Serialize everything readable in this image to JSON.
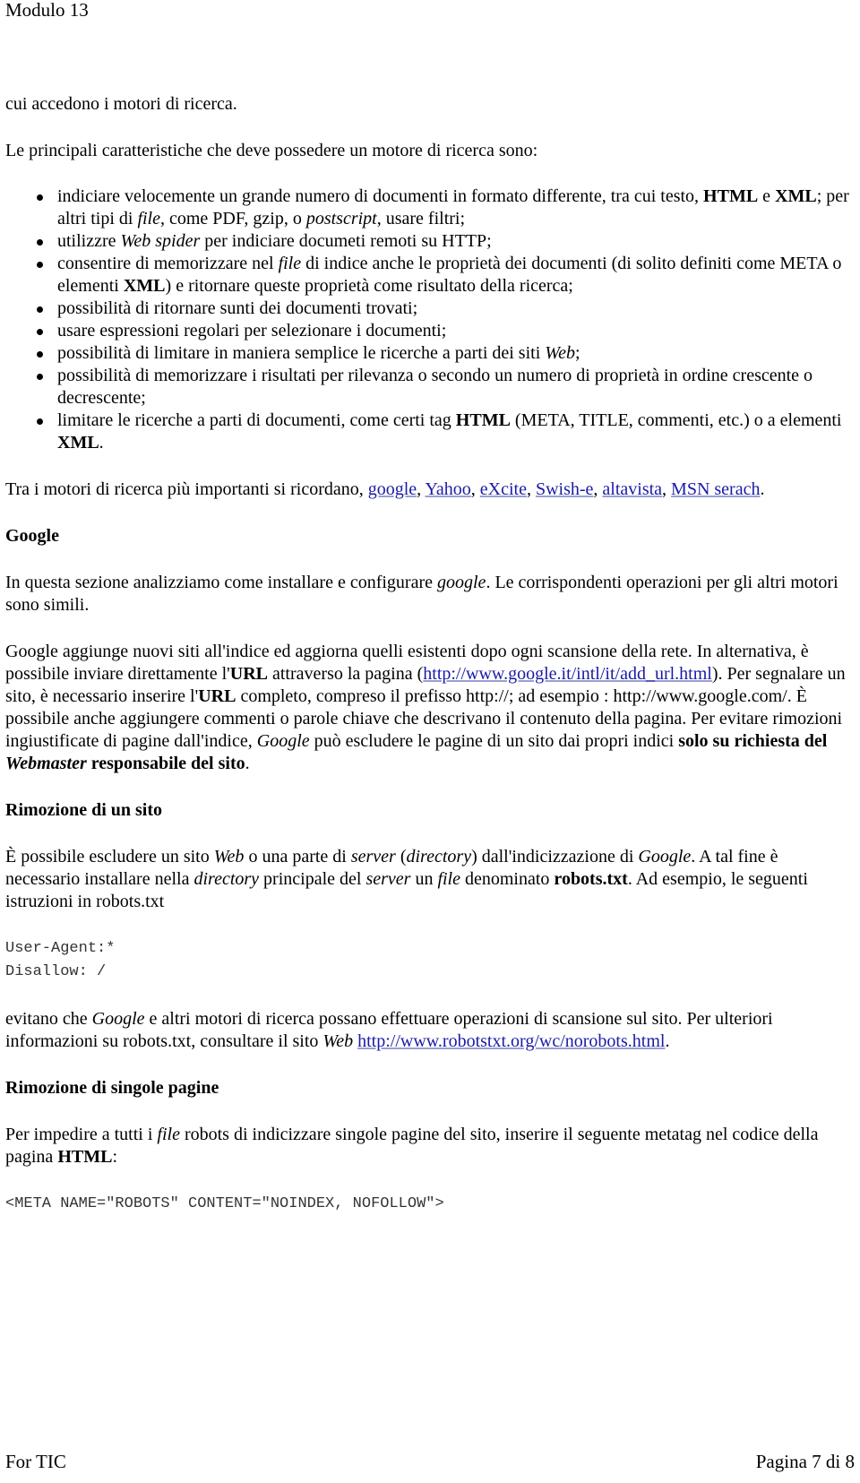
{
  "header": {
    "title": "Modulo 13"
  },
  "intro": {
    "continuation": "cui accedono i motori di ricerca.",
    "features_lead": "Le principali caratteristiche che deve possedere un motore di ricerca sono:"
  },
  "features": [
    {
      "parts": [
        {
          "t": "indiciare velocemente un grande numero di documenti in formato differente, tra cui testo, "
        },
        {
          "t": "HTML",
          "b": true
        },
        {
          "t": " e "
        },
        {
          "t": "XML",
          "b": true
        },
        {
          "t": "; per altri tipi di "
        },
        {
          "t": "file",
          "i": true
        },
        {
          "t": ", come PDF, gzip, o "
        },
        {
          "t": "postscript",
          "i": true
        },
        {
          "t": ", usare filtri;"
        }
      ]
    },
    {
      "parts": [
        {
          "t": "utilizzre "
        },
        {
          "t": "Web spider",
          "i": true
        },
        {
          "t": " per indiciare documeti remoti su HTTP;"
        }
      ]
    },
    {
      "parts": [
        {
          "t": "consentire di memorizzare nel "
        },
        {
          "t": "file",
          "i": true
        },
        {
          "t": " di indice anche le proprietà dei documenti (di solito definiti come META o elementi "
        },
        {
          "t": "XML",
          "b": true
        },
        {
          "t": ") e ritornare queste proprietà come risultato della ricerca;"
        }
      ]
    },
    {
      "parts": [
        {
          "t": "possibilità di ritornare sunti dei documenti trovati;"
        }
      ]
    },
    {
      "parts": [
        {
          "t": "usare espressioni regolari per selezionare i documenti;"
        }
      ]
    },
    {
      "parts": [
        {
          "t": "possibilità di limitare in maniera semplice le ricerche a parti dei siti "
        },
        {
          "t": "Web",
          "i": true
        },
        {
          "t": ";"
        }
      ]
    },
    {
      "parts": [
        {
          "t": "possibilità di memorizzare i risultati per rilevanza o secondo un numero di proprietà in ordine crescente o decrescente;"
        }
      ]
    },
    {
      "parts": [
        {
          "t": "limitare le ricerche a parti di documenti, come certi tag "
        },
        {
          "t": "HTML",
          "b": true
        },
        {
          "t": " (META, TITLE, commenti, etc.) o a elementi "
        },
        {
          "t": "XML",
          "b": true
        },
        {
          "t": "."
        }
      ]
    }
  ],
  "engines": {
    "lead": "Tra i motori di ricerca più importanti si ricordano, ",
    "links": [
      "google",
      "Yahoo",
      "eXcite",
      "Swish-e",
      "altavista",
      "MSN serach"
    ],
    "separator": ", ",
    "end": "."
  },
  "google_section": {
    "heading": "Google",
    "p1": [
      {
        "t": "In questa sezione analizziamo come installare e configurare "
      },
      {
        "t": "google",
        "i": true
      },
      {
        "t": ". Le corrispondenti operazioni per gli altri motori sono simili."
      }
    ],
    "p2": [
      {
        "t": "Google aggiunge nuovi siti all'indice ed aggiorna quelli esistenti dopo ogni scansione della rete. In alternativa, è possibile inviare direttamente l'"
      },
      {
        "t": "URL",
        "b": true
      },
      {
        "t": " attraverso la pagina ("
      },
      {
        "t": "http://www.google.it/intl/it/add_url.html",
        "link": true
      },
      {
        "t": "). Per segnalare un sito, è necessario inserire l'"
      },
      {
        "t": "URL",
        "b": true
      },
      {
        "t": " completo, compreso il prefisso http://; ad esempio : http://www.google.com/. È possibile anche aggiungere commenti o parole chiave che descrivano il contenuto della pagina. Per evitare rimozioni ingiustificate di pagine dall'indice, "
      },
      {
        "t": "Google",
        "i": true
      },
      {
        "t": " può escludere le pagine di un sito dai propri indici "
      },
      {
        "t": "solo su richiesta del ",
        "b": true
      },
      {
        "t": "Webmaster",
        "b": true,
        "i": true
      },
      {
        "t": " responsabile del sito",
        "b": true
      },
      {
        "t": "."
      }
    ]
  },
  "site_removal": {
    "heading": "Rimozione di un sito",
    "p1": [
      {
        "t": "È possibile escludere un sito "
      },
      {
        "t": "Web",
        "i": true
      },
      {
        "t": " o una parte di "
      },
      {
        "t": "server",
        "i": true
      },
      {
        "t": " ("
      },
      {
        "t": "directory",
        "i": true
      },
      {
        "t": ") dall'indicizzazione di "
      },
      {
        "t": "Google",
        "i": true
      },
      {
        "t": ". A tal fine è necessario installare nella "
      },
      {
        "t": "directory",
        "i": true
      },
      {
        "t": " principale del "
      },
      {
        "t": "server",
        "i": true
      },
      {
        "t": " un "
      },
      {
        "t": "file",
        "i": true
      },
      {
        "t": " denominato "
      },
      {
        "t": "robots.txt",
        "b": true
      },
      {
        "t": ". Ad esempio, le seguenti istruzioni in robots.txt"
      }
    ],
    "code": "User-Agent:*\nDisallow: /",
    "p2": [
      {
        "t": "evitano che "
      },
      {
        "t": "Google",
        "i": true
      },
      {
        "t": " e altri motori di ricerca possano effettuare operazioni di scansione sul sito. Per ulteriori informazioni su robots.txt, consultare il sito "
      },
      {
        "t": "Web",
        "i": true
      },
      {
        "t": " "
      },
      {
        "t": "http://www.robotstxt.org/wc/norobots.html",
        "link": true
      },
      {
        "t": "."
      }
    ]
  },
  "page_removal": {
    "heading": "Rimozione di singole pagine",
    "p1": [
      {
        "t": "Per impedire a tutti i "
      },
      {
        "t": "file",
        "i": true
      },
      {
        "t": " robots di indicizzare singole pagine del sito, inserire il seguente metatag nel codice della pagina "
      },
      {
        "t": "HTML",
        "b": true
      },
      {
        "t": ":"
      }
    ],
    "code": "<META NAME=\"ROBOTS\" CONTENT=\"NOINDEX, NOFOLLOW\">"
  },
  "footer": {
    "left": "For TIC",
    "right": "Pagina 7 di 8"
  },
  "colors": {
    "link": "#1a1aa6",
    "text": "#000000",
    "code": "#333333"
  }
}
